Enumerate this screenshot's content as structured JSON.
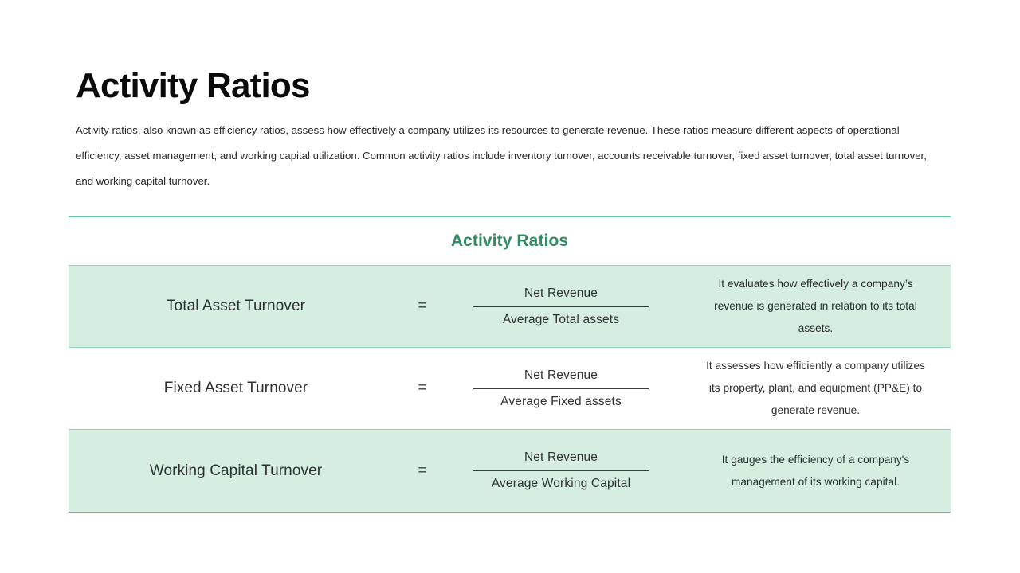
{
  "slide": {
    "title": "Activity Ratios",
    "intro": "Activity ratios, also known as efficiency ratios, assess how effectively a company utilizes its resources to generate revenue. These ratios measure different aspects of operational efficiency, asset management, and working capital utilization. Common activity ratios include inventory turnover, accounts receivable turnover, fixed asset turnover, total asset turnover, and working capital turnover."
  },
  "table": {
    "caption": "Activity Ratios",
    "equals_symbol": "=",
    "rows": [
      {
        "name": "Total Asset Turnover",
        "numerator": "Net Revenue",
        "denominator": "Average Total assets",
        "description": "It evaluates how effectively a company’s revenue is generated in relation to its total assets."
      },
      {
        "name": "Fixed Asset Turnover",
        "numerator": "Net Revenue",
        "denominator": "Average Fixed assets",
        "description": "It assesses how efficiently a company utilizes its property, plant, and equipment (PP&E) to generate revenue."
      },
      {
        "name": "Working Capital Turnover",
        "numerator": "Net Revenue",
        "denominator": "Average Working Capital",
        "description": "It gauges the efficiency of a company's management of its working capital."
      }
    ]
  },
  "colors": {
    "accent_green": "#2e8b62",
    "rule_green": "#63c6a0",
    "row_shade": "#d5eee0",
    "body_text": "#26282b",
    "title_text": "#0b0b0b"
  }
}
